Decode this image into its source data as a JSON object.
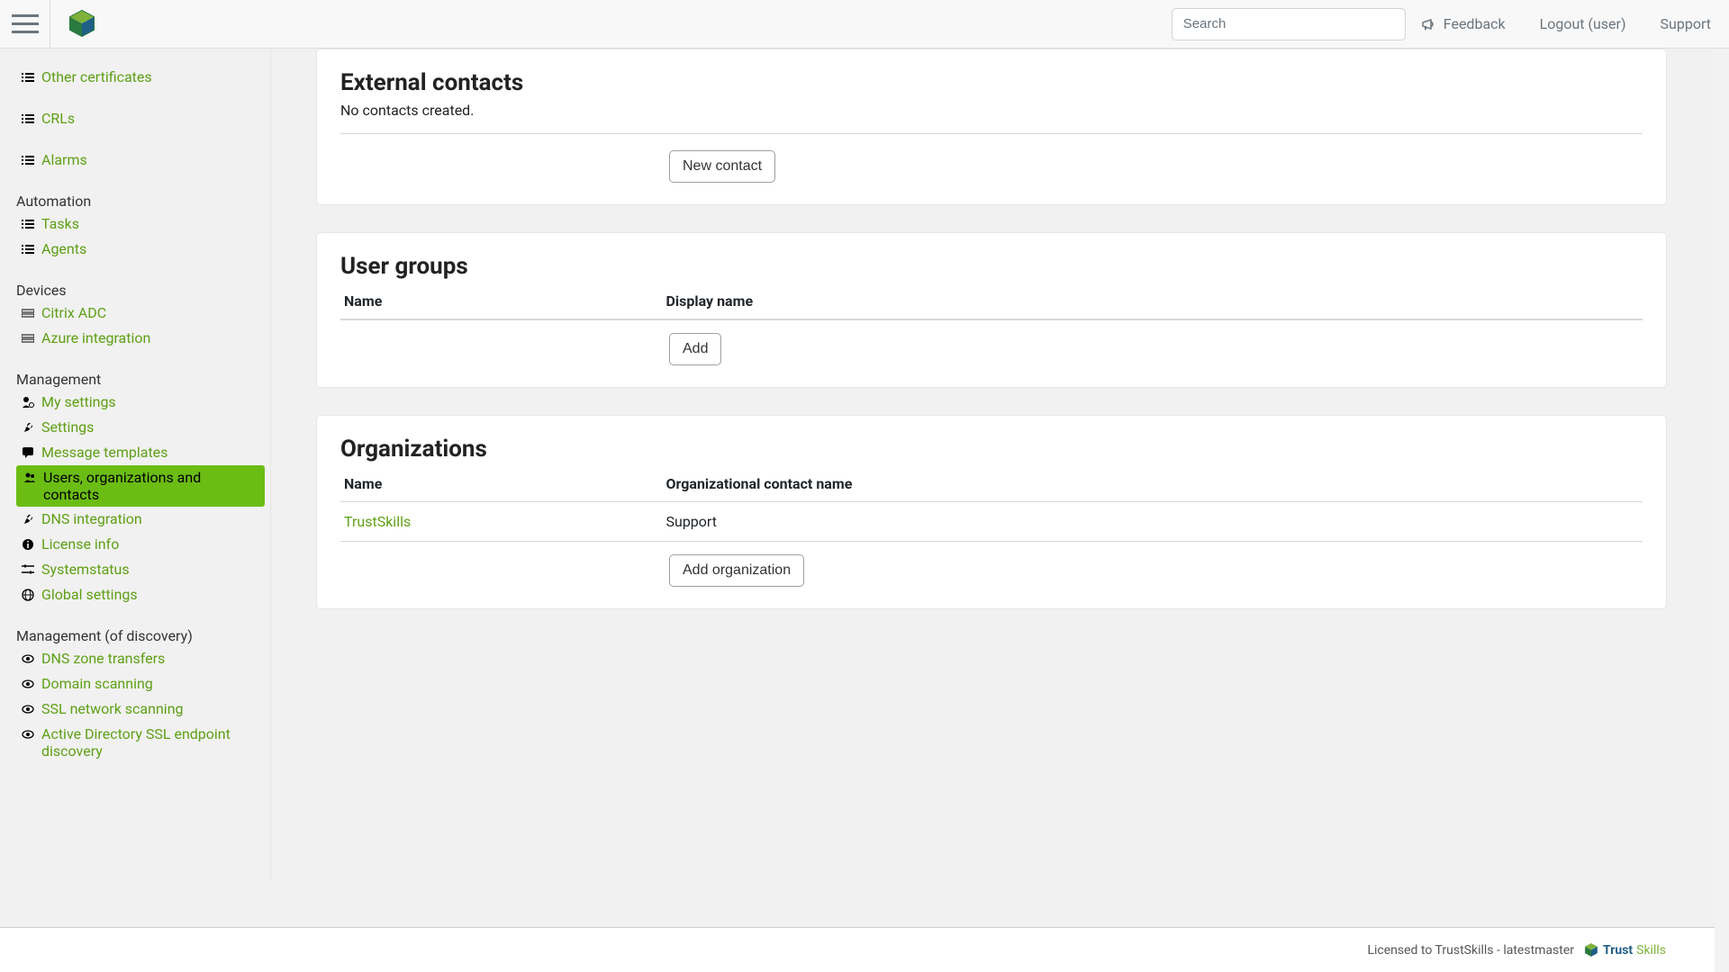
{
  "header": {
    "search_placeholder": "Search",
    "feedback": "Feedback",
    "logout": "Logout (user)",
    "support": "Support"
  },
  "sidebar": {
    "certs": {
      "other_certificates": "Other certificates",
      "crls": "CRLs",
      "alarms": "Alarms"
    },
    "automation": {
      "title": "Automation",
      "tasks": "Tasks",
      "agents": "Agents"
    },
    "devices": {
      "title": "Devices",
      "citrix": "Citrix ADC",
      "azure": "Azure integration"
    },
    "management": {
      "title": "Management",
      "my_settings": "My settings",
      "settings": "Settings",
      "message_templates": "Message templates",
      "users_orgs": "Users, organizations and contacts",
      "dns_integration": "DNS integration",
      "license_info": "License info",
      "systemstatus": "Systemstatus",
      "global_settings": "Global settings"
    },
    "management_discovery": {
      "title": "Management (of discovery)",
      "dns_zone": "DNS zone transfers",
      "domain_scanning": "Domain scanning",
      "ssl_network": "SSL network scanning",
      "ad_ssl": "Active Directory SSL endpoint discovery"
    }
  },
  "main": {
    "external_contacts": {
      "heading": "External contacts",
      "empty_text": "No contacts created.",
      "new_button": "New contact"
    },
    "user_groups": {
      "heading": "User groups",
      "col_name": "Name",
      "col_display": "Display name",
      "add_button": "Add"
    },
    "organizations": {
      "heading": "Organizations",
      "col_name": "Name",
      "col_contact": "Organizational contact name",
      "row0_name": "TrustSkills",
      "row0_contact": "Support",
      "add_button": "Add organization"
    }
  },
  "footer": {
    "text": "Licensed to TrustSkills - latestmaster",
    "brand_prefix": "Trust",
    "brand_suffix": "Skills"
  }
}
